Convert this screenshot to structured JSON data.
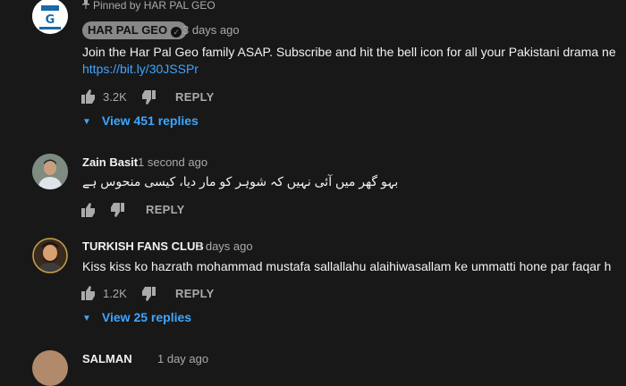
{
  "pinned": {
    "label": "Pinned by HAR PAL GEO",
    "author": "HAR PAL GEO",
    "time": "3 days ago",
    "text": "Join the Har Pal Geo family ASAP. Subscribe and hit the bell icon for all your Pakistani drama ne",
    "link": "https://bit.ly/30JSSPr",
    "likes": "3.2K",
    "reply_label": "REPLY",
    "view_replies": "View 451 replies"
  },
  "comments": [
    {
      "author": "Zain Basit",
      "time": "1 second ago",
      "text": "بہو گھر میں آئی نہیں کہ شوہر کو مار دیا، کیسی منحوس ہے",
      "likes": "",
      "reply_label": "REPLY"
    },
    {
      "author": "TURKISH FANS CLUB",
      "time": "3 days ago",
      "text": "Kiss kiss ko hazrath mohammad mustafa sallallahu alaihiwasallam ke ummatti hone par faqar h",
      "likes": "1.2K",
      "reply_label": "REPLY",
      "view_replies": "View 25 replies"
    },
    {
      "author": "SALMAN",
      "time": "1 day ago"
    }
  ],
  "colors": {
    "background": "#181818",
    "link": "#3ea6ff",
    "secondary": "#aaaaaa"
  },
  "icons": [
    "pin-icon",
    "verified-check-icon",
    "thumbs-up-icon",
    "thumbs-down-icon",
    "caret-down-icon"
  ]
}
